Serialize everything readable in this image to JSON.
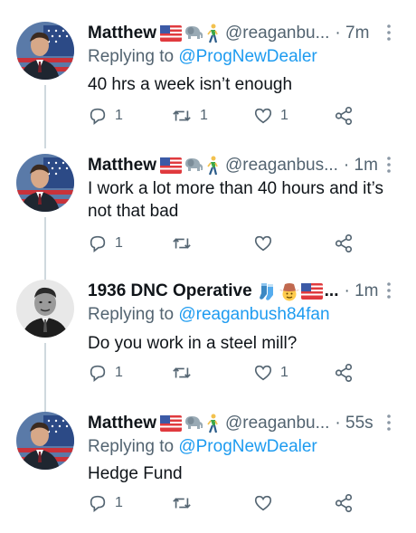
{
  "tweets": [
    {
      "name": "Matthew",
      "handle": "@reaganbu...",
      "time": "· 7m",
      "emojis": [
        "us-flag-emoji",
        "elephant-emoji",
        "person-walking-emoji"
      ],
      "replying_prefix": "Replying to ",
      "replying_to": "@ProgNewDealer",
      "text": "40 hrs a week isn’t enough",
      "reply_count": "1",
      "retweet_count": "1",
      "like_count": "1"
    },
    {
      "name": "Matthew",
      "handle": "@reaganbus...",
      "time": "· 1m",
      "emojis": [
        "us-flag-emoji",
        "elephant-emoji",
        "person-walking-emoji"
      ],
      "replying_prefix": "",
      "replying_to": "",
      "text": "I work a lot more than 40 hours and it’s not that bad",
      "reply_count": "1",
      "retweet_count": "",
      "like_count": ""
    },
    {
      "name": "1936 DNC Operative",
      "handle": "",
      "time": "· 1m",
      "emojis": [
        "socks-emoji",
        "cowboy-emoji",
        "us-flag-emoji"
      ],
      "replying_prefix": "Replying to ",
      "replying_to": "@reaganbush84fan",
      "text": "Do you work in a steel mill?",
      "reply_count": "1",
      "retweet_count": "",
      "like_count": "1"
    },
    {
      "name": "Matthew",
      "handle": "@reaganbu...",
      "time": "· 55s",
      "emojis": [
        "us-flag-emoji",
        "elephant-emoji",
        "person-walking-emoji"
      ],
      "replying_prefix": "Replying to ",
      "replying_to": "@ProgNewDealer",
      "text": "Hedge Fund",
      "reply_count": "1",
      "retweet_count": "",
      "like_count": ""
    }
  ],
  "ellipsis": "...",
  "colors": {
    "link": "#1d9bf0",
    "secondary": "#536471",
    "thread_line": "#cfd9de"
  }
}
